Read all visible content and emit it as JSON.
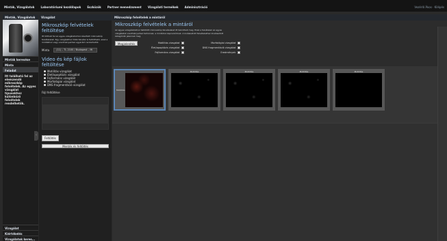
{
  "topnav": {
    "items": [
      "Minták, Vizsgálatok",
      "Laboratóriumi kezdőlapok",
      "Eszközök",
      "Partner menedzsment",
      "Vizsgálati termékek",
      "Adminisztráció"
    ],
    "right": "Vezérlő Ákos · Kilépés"
  },
  "leftnav": {
    "header": "Minták, Vizsgálatok",
    "items": [
      "Minták keresése",
      "Minta",
      "Feladat"
    ],
    "desc": "Itt található fel az elemzendő mikroszkóp felvételek. Az egyes vizsgálat típusokhoz különböző felvételek rendelhetők.",
    "bottom": [
      "Vizsgálat",
      "Kiértékelés",
      "Vizsgálatok keres..."
    ]
  },
  "leftpanel": {
    "header": "Vizsgálat",
    "title": "Mikroszkóp felvételek feltöltése",
    "desc": "Itt töltheti fel az egyes vizsgálatokhoz készített mikroszkóp felvételeket. Egy vizsgálathoz több felvétel is feltölthető, ezek a mintákhoz vagy eredményekhez egyaránt rendelhetők.",
    "minta_label": "Minta",
    "minta_value": "(11) – TL 2100 / Budapest – Mi",
    "video_title": "Video és kép fájlok feltöltése",
    "radios": [
      "Motilitás vizsgálat",
      "Élet/apoptózis vizsgálat",
      "Fejformáns vizsgálat",
      "Morfológiai vizsgálat",
      "DNS fragmentáció vizsgálat"
    ],
    "upload_label": "Fájl feltöltése",
    "upload_button": "Feltöltés",
    "save_button": "Mentés és feltöltés"
  },
  "main": {
    "header": "Mikroszkóp felvételek a mintáról",
    "title": "Mikroszkóp felvételek a mintáról",
    "desc": "Az egyes vizsgálatokhoz feltöltött mikroszkóp felvételeket itt tekintheti meg. Ezek a felvételek az egyes vizsgálatok eredményeihez tartoznak, a mintához kapcsolódnak. A kiválasztott felvételekhez kiválasztott kategóriák jelennek meg.",
    "button": "Megjelenítés",
    "checks_left": [
      {
        "label": "Motilitás vizsgálat",
        "checked": true
      },
      {
        "label": "Élet/apoptózis vizsgálat",
        "checked": true
      },
      {
        "label": "Fejformáns vizsgálat",
        "checked": true
      }
    ],
    "checks_right": [
      {
        "label": "Morfológiai vizsgálat",
        "checked": true
      },
      {
        "label": "DNS fragmentáció vizsgálat",
        "checked": true
      },
      {
        "label": "Eredmények",
        "checked": true
      }
    ],
    "thumbs": [
      {
        "title": "Motilitás",
        "style": "red",
        "selected": true
      },
      {
        "title": "Motilitás",
        "style": "dots",
        "selected": false
      },
      {
        "title": "Motilitás",
        "style": "dots",
        "selected": false
      },
      {
        "title": "Motilitás",
        "style": "dots",
        "selected": false
      },
      {
        "title": "Motilitás",
        "style": "plain",
        "selected": false
      }
    ]
  }
}
